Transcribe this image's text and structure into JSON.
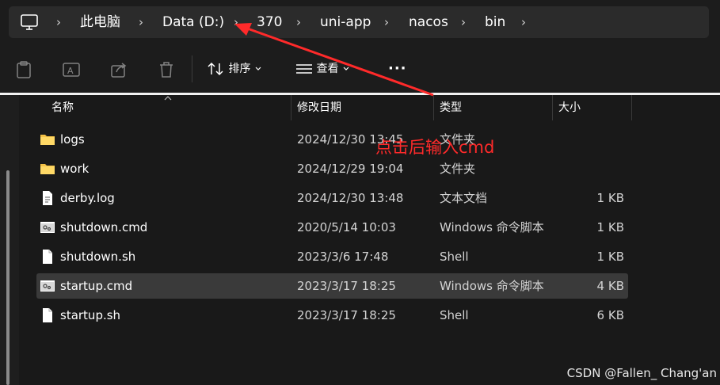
{
  "breadcrumb": {
    "items": [
      "此电脑",
      "Data (D:)",
      "370",
      "uni-app",
      "nacos",
      "bin"
    ],
    "separator": "›"
  },
  "toolbar": {
    "sort_label": "排序",
    "view_label": "查看",
    "more_label": "···"
  },
  "columns": {
    "name": "名称",
    "date": "修改日期",
    "type": "类型",
    "size": "大小"
  },
  "files": [
    {
      "name": "logs",
      "date": "2024/12/30 13:45",
      "type": "文件夹",
      "size": "",
      "icon": "folder-icon"
    },
    {
      "name": "work",
      "date": "2024/12/29 19:04",
      "type": "文件夹",
      "size": "",
      "icon": "folder-icon"
    },
    {
      "name": "derby.log",
      "date": "2024/12/30 13:48",
      "type": "文本文档",
      "size": "1 KB",
      "icon": "text-file-icon"
    },
    {
      "name": "shutdown.cmd",
      "date": "2020/5/14 10:03",
      "type": "Windows 命令脚本",
      "size": "1 KB",
      "icon": "cmd-file-icon"
    },
    {
      "name": "shutdown.sh",
      "date": "2023/3/6 17:48",
      "type": "Shell",
      "size": "1 KB",
      "icon": "file-icon"
    },
    {
      "name": "startup.cmd",
      "date": "2023/3/17 18:25",
      "type": "Windows 命令脚本",
      "size": "4 KB",
      "icon": "cmd-file-icon",
      "selected": true
    },
    {
      "name": "startup.sh",
      "date": "2023/3/17 18:25",
      "type": "Shell",
      "size": "6 KB",
      "icon": "file-icon"
    }
  ],
  "annotation": {
    "text": "点击后输入cmd",
    "color": "#ff2a2a"
  },
  "watermark": "CSDN @Fallen_ Chang'an",
  "colors": {
    "background": "#1c1c1c",
    "address_bar": "#2b2b2b",
    "selected_row": "#3a3a3a",
    "folder": "#f3c146"
  }
}
